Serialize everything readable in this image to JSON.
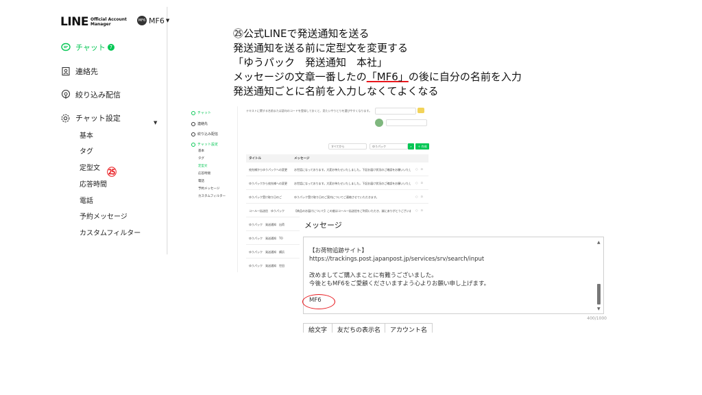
{
  "sidebar": {
    "logo_main": "LINE",
    "logo_sub_1": "Official Account",
    "logo_sub_2": "Manager",
    "account_avatar": "MF6",
    "account_name": "MF6",
    "nav": [
      {
        "label": "チャット",
        "badge": "7",
        "icon": "chat-icon"
      },
      {
        "label": "連絡先",
        "icon": "contacts-icon"
      },
      {
        "label": "絞り込み配信",
        "icon": "broadcast-icon"
      },
      {
        "label": "チャット設定",
        "icon": "gear-icon"
      }
    ],
    "sub_items": [
      "基本",
      "タグ",
      "定型文",
      "応答時間",
      "電話",
      "予約メッセージ",
      "カスタムフィルター"
    ],
    "step_marker": "㉕"
  },
  "instructions": {
    "line1": "㉕公式LINEで発送通知を送る",
    "line2": "発送通知を送る前に定型文を変更する",
    "line3": "「ゆうパック　発送通知　本社」",
    "line4_pre": "メッセージの文章一番したの",
    "line4_mark": "「MF6」",
    "line4_post": "の後に自分の名前を入力",
    "line5": "発送通知ごとに名前を入力しなくてよくなる"
  },
  "mini": {
    "nav": [
      "チャット",
      "連絡先",
      "絞り込み配信",
      "チャット設定"
    ],
    "subs": [
      "基本",
      "タグ",
      "定型文",
      "応答時間",
      "電話",
      "予約メッセージ",
      "カスタムフィルター"
    ],
    "top_text": "テキストに関する名前または語句のコードを登録しておくと、見たいやりとりを選びやすくなります。",
    "filter": "すべてから",
    "search": "ゆうパック",
    "create_btn": "＋ 作成",
    "col_title": "タイトル",
    "col_message": "メッセージ",
    "rows": [
      {
        "title": "宛先様からゆうパックへの変更",
        "message": "お世話になっております。大変お待たせいたしました。下記お届け状況のご確認をお願いいたします。"
      },
      {
        "title": "ゆうパックから宛先様への変更",
        "message": "お世話になっております。大変お待たせいたしました。下記お届け状況のご確認をお願いいたします。"
      },
      {
        "title": "ゆうパック受け取り日のご",
        "message": "ゆうパック受け取り日のご案内についてご連絡させていただきます。"
      },
      {
        "title": "コール一括送信　ゆうパック",
        "message": "【商品のお届けについて】この度はコール一括送信をご利用いただき、誠にありがとうございます。"
      },
      {
        "title": "ゆうパック　発送通知　出荷",
        "message": ""
      },
      {
        "title": "ゆうパック　発送通知　TO",
        "message": ""
      },
      {
        "title": "ゆうパック　発送通知　横浜",
        "message": ""
      },
      {
        "title": "ゆうパック　発送通知　世田",
        "message": ""
      },
      {
        "title": "ゆうパック　発送通知　本社",
        "message": ""
      }
    ]
  },
  "editor": {
    "label": "メッセージ",
    "lines": [
      "【お荷物追跡サイト】",
      "https://trackings.post.japanpost.jp/services/srv/search/input",
      "",
      "改めましてご購入まことに有難うございました。",
      "今後ともMF6をご愛顧くださいますよう心よりお願い申し上げます。",
      "",
      "MF6"
    ],
    "counter": "400/1000",
    "tools": [
      "絵文字",
      "友だちの表示名",
      "アカウント名"
    ]
  },
  "colors": {
    "line_green": "#06c755",
    "annotation_red": "#e8161b"
  }
}
